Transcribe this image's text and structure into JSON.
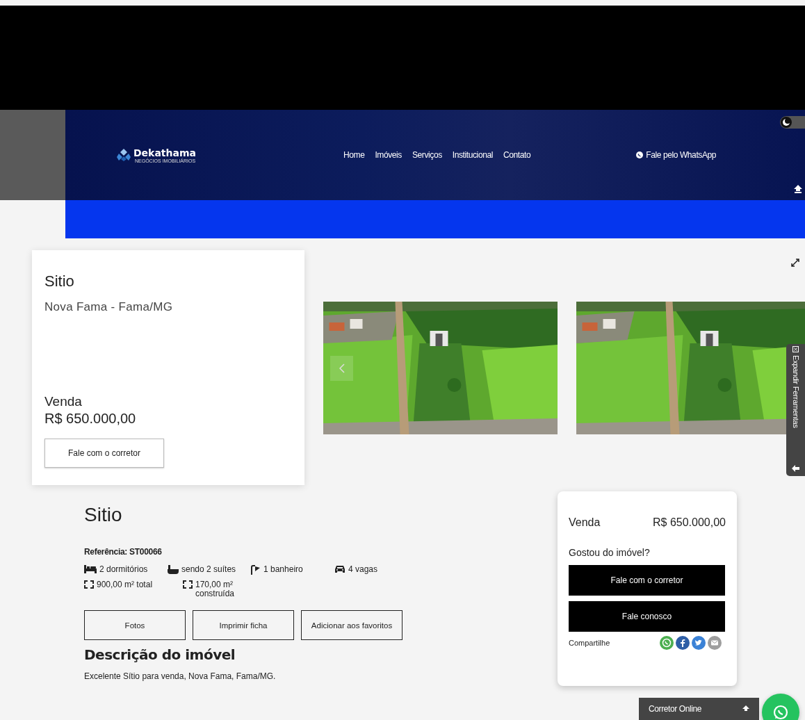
{
  "header": {
    "logo": {
      "name": "Dekathama",
      "tagline": "NEGÓCIOS IMOBILIÁRIOS"
    },
    "nav": [
      {
        "label": "Home"
      },
      {
        "label": "Imóveis"
      },
      {
        "label": "Serviços"
      },
      {
        "label": "Institucional"
      },
      {
        "label": "Contato"
      }
    ],
    "whatsapp": "Fale pelo WhatsApp",
    "dark_mode": {
      "on": false
    }
  },
  "summary_card": {
    "title": "Sitio",
    "location": "Nova Fama - Fama/MG",
    "deal": "Venda",
    "price": "R$ 650.000,00",
    "button": "Fale com o corretor"
  },
  "tools_tab": {
    "label": "Expandir Ferramentas"
  },
  "details": {
    "title": "Sitio",
    "reference": "Referência: ST00066",
    "feature_rows": [
      [
        {
          "kind": "bed",
          "text": "2 dormitórios"
        },
        {
          "kind": "bath",
          "text": "sendo 2 suítes"
        },
        {
          "kind": "shower",
          "text": "1 banheiro"
        },
        {
          "kind": "car",
          "text": "4 vagas"
        }
      ],
      [
        {
          "kind": "area",
          "text": "900,00 m² total"
        },
        {
          "kind": "area",
          "text": "170,00 m² construída"
        }
      ]
    ],
    "actions": [
      "Fotos",
      "Imprimir ficha",
      "Adicionar aos favoritos"
    ],
    "description_title": "Descrição do imóvel",
    "description": "Excelente Sítio para venda, Nova Fama, Fama/MG."
  },
  "contact_card": {
    "deal": "Venda",
    "price": "R$ 650.000,00",
    "question": "Gostou do imóvel?",
    "buttons": [
      "Fale com o corretor",
      "Fale conosco"
    ],
    "share_label": "Compartilhe",
    "share": [
      {
        "kind": "whatsapp"
      },
      {
        "kind": "facebook"
      },
      {
        "kind": "twitter"
      },
      {
        "kind": "email"
      }
    ]
  },
  "chat_bar": {
    "label": "Corretor Online"
  }
}
